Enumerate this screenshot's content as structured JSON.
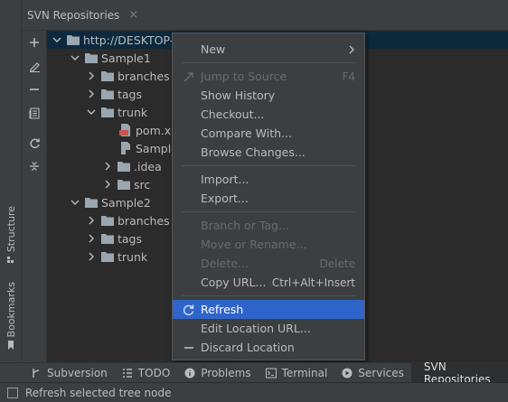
{
  "window": {
    "title": "SVN Repositories",
    "close_glyph": "×"
  },
  "side_tabs": {
    "structure": "Structure",
    "bookmarks": "Bookmarks"
  },
  "toolbar_icons": [
    "add-icon",
    "edit-icon",
    "remove-icon",
    "browse-changes-icon",
    "refresh-icon",
    "collapse-icon"
  ],
  "tree": {
    "root": "http://DESKTOP-",
    "sample1": "Sample1",
    "s1_branches": "branches",
    "s1_tags": "tags",
    "s1_trunk": "trunk",
    "pom": "pom.xn",
    "sample_file": "Sample",
    "idea": ".idea",
    "src": "src",
    "sample2": "Sample2",
    "s2_branches": "branches",
    "s2_tags": "tags",
    "s2_trunk": "trunk"
  },
  "menu": {
    "new": "New",
    "jump": "Jump to Source",
    "jump_sc": "F4",
    "show_history": "Show History",
    "checkout": "Checkout...",
    "compare": "Compare With...",
    "browse": "Browse Changes...",
    "import": "Import...",
    "export": "Export...",
    "branch": "Branch or Tag...",
    "move": "Move or Rename...",
    "delete": "Delete...",
    "delete_sc": "Delete",
    "copy_url": "Copy URL...",
    "copy_url_sc": "Ctrl+Alt+Insert",
    "refresh": "Refresh",
    "edit_location": "Edit Location URL...",
    "discard": "Discard Location"
  },
  "bottom_tabs": {
    "subversion": "Subversion",
    "todo": "TODO",
    "problems": "Problems",
    "terminal": "Terminal",
    "services": "Services",
    "svn": "SVN Repositories"
  },
  "status": {
    "text": "Refresh selected tree node"
  },
  "colors": {
    "selection": "#2f65ca",
    "tree_selection": "#0d293e",
    "folder": "#9aa7b0"
  }
}
